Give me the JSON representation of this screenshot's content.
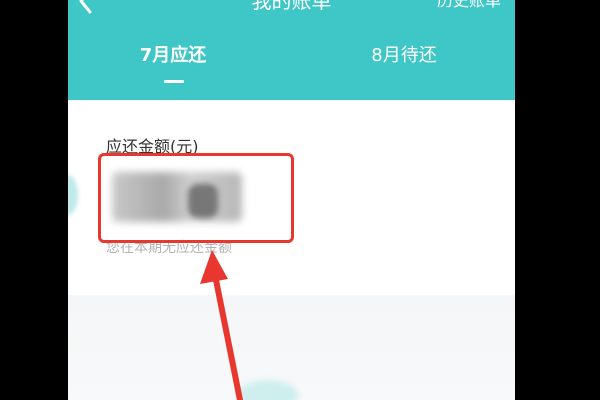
{
  "header": {
    "title": "我的账单",
    "history_label": "历史账单",
    "back_icon": "chevron-left-icon"
  },
  "tabs": [
    {
      "label": "7月应还",
      "active": true
    },
    {
      "label": "8月待还",
      "active": false
    }
  ],
  "card": {
    "amount_label": "应还金额(元)",
    "note": "您在本期无应还金额"
  },
  "colors": {
    "header_bg": "#3fc6c6",
    "annotation_red": "#e8372f"
  }
}
